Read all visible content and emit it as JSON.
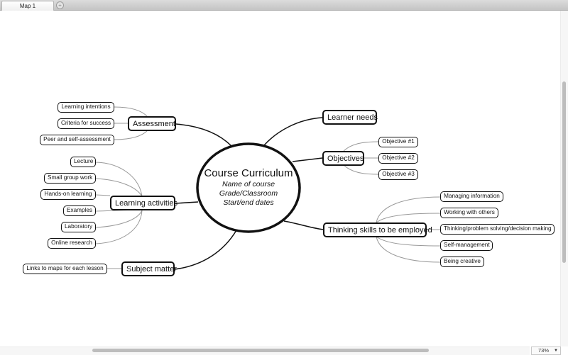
{
  "window": {
    "tabs": [
      {
        "label": "Map 1",
        "active": true
      }
    ],
    "add_tab_icon": "plus-circle-icon"
  },
  "map": {
    "central_topic": {
      "title": "Course Curriculum",
      "lines": [
        "Name of course",
        "Grade/Classroom",
        "Start/end dates"
      ]
    },
    "branches": {
      "assessment": {
        "label": "Assessment",
        "children": [
          "Learning intentions",
          "Criteria for success",
          "Peer and self-assessment"
        ]
      },
      "learning_activities": {
        "label": "Learning activities",
        "children": [
          "Lecture",
          "Small group work",
          "Hands-on learning",
          "Examples",
          "Laboratory",
          "Online research"
        ]
      },
      "subject_matter": {
        "label": "Subject matter",
        "children": [
          "Links to maps for each lesson"
        ]
      },
      "learner_needs": {
        "label": "Learner needs",
        "children": []
      },
      "objectives": {
        "label": "Objectives",
        "children": [
          "Objective #1",
          "Objective #2",
          "Objective #3"
        ]
      },
      "thinking_skills": {
        "label": "Thinking skills to be employed",
        "children": [
          "Managing information",
          "Working with others",
          "Thinking/problem solving/decision making",
          "Self-management",
          "Being creative"
        ]
      }
    }
  },
  "statusbar": {
    "zoom_level": "73%"
  },
  "colors": {
    "node_border": "#111111",
    "main_connector": "#111111",
    "sub_connector": "#999999",
    "scroll_thumb": "#bdbdbd"
  }
}
